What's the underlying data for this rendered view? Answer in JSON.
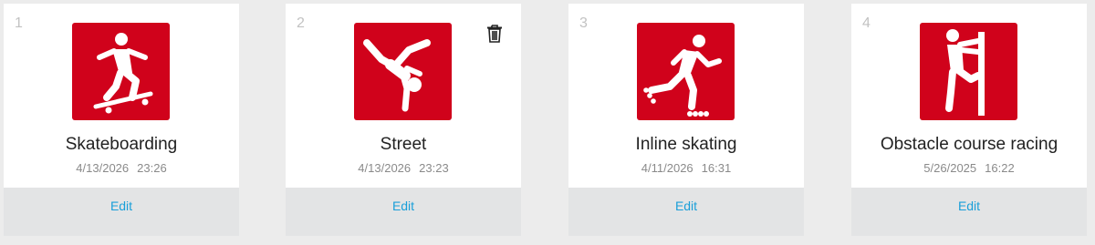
{
  "colors": {
    "page_background": "#ececec",
    "card_background": "#ffffff",
    "pictogram_red": "#d0021b",
    "footer_background": "#e3e4e5",
    "link_blue": "#1a9fd9"
  },
  "cards": [
    {
      "number": "1",
      "icon": "skateboarding-icon",
      "title": "Skateboarding",
      "date": "4/13/2026",
      "time": "23:26",
      "edit_label": "Edit",
      "has_trash": false
    },
    {
      "number": "2",
      "icon": "street-icon",
      "title": "Street",
      "date": "4/13/2026",
      "time": "23:23",
      "edit_label": "Edit",
      "has_trash": true,
      "trash_icon": "trash-icon"
    },
    {
      "number": "3",
      "icon": "inline-skating-icon",
      "title": "Inline skating",
      "date": "4/11/2026",
      "time": "16:31",
      "edit_label": "Edit",
      "has_trash": false
    },
    {
      "number": "4",
      "icon": "obstacle-course-racing-icon",
      "title": "Obstacle course racing",
      "date": "5/26/2025",
      "time": "16:22",
      "edit_label": "Edit",
      "has_trash": false
    }
  ]
}
